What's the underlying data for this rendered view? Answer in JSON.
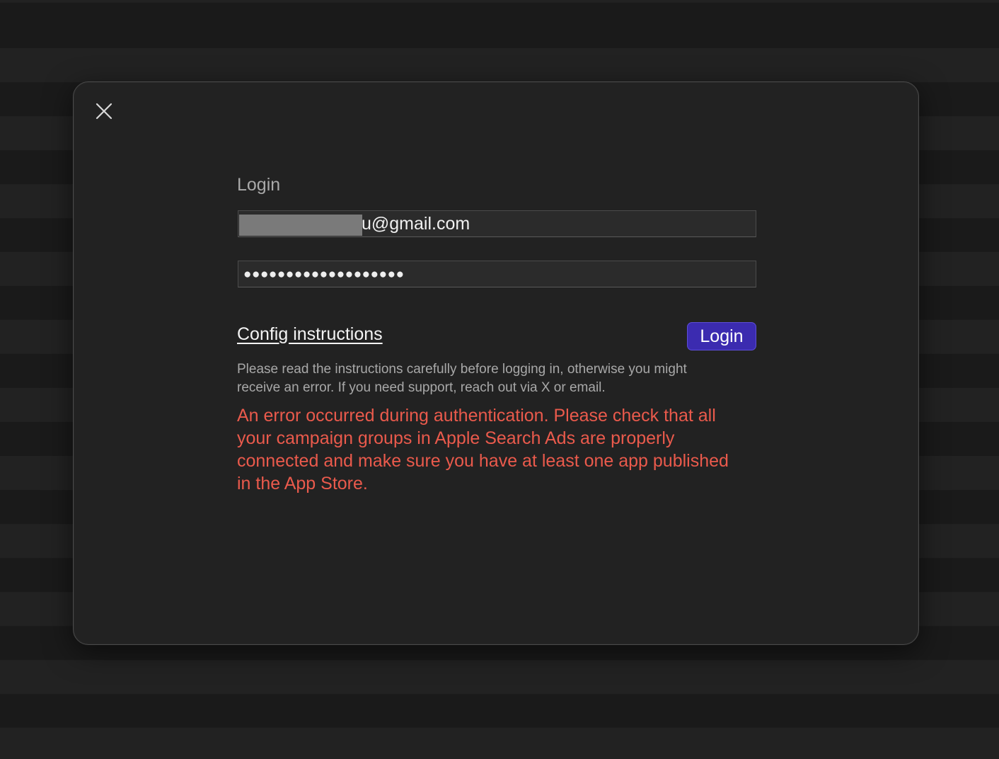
{
  "dialog": {
    "close_icon": "close-icon",
    "title": "Login",
    "email": {
      "visible_value": "u@gmail.com",
      "redacted": true
    },
    "password": {
      "masked_value": "●●●●●●●●●●●●●●●●●●●"
    },
    "config_link_label": "Config instructions",
    "login_button_label": "Login",
    "help_text": "Please read the instructions carefully before logging in, otherwise you might receive an error. If you need support, reach out via X or email.",
    "error_text": "An error occurred during authentication. Please check that all your campaign groups in Apple Search Ads are properly connected and make sure you have at least one app published in the App Store."
  },
  "colors": {
    "accent": "#3b2bb0",
    "error": "#ea5a4c",
    "dialog_bg": "#222222"
  }
}
